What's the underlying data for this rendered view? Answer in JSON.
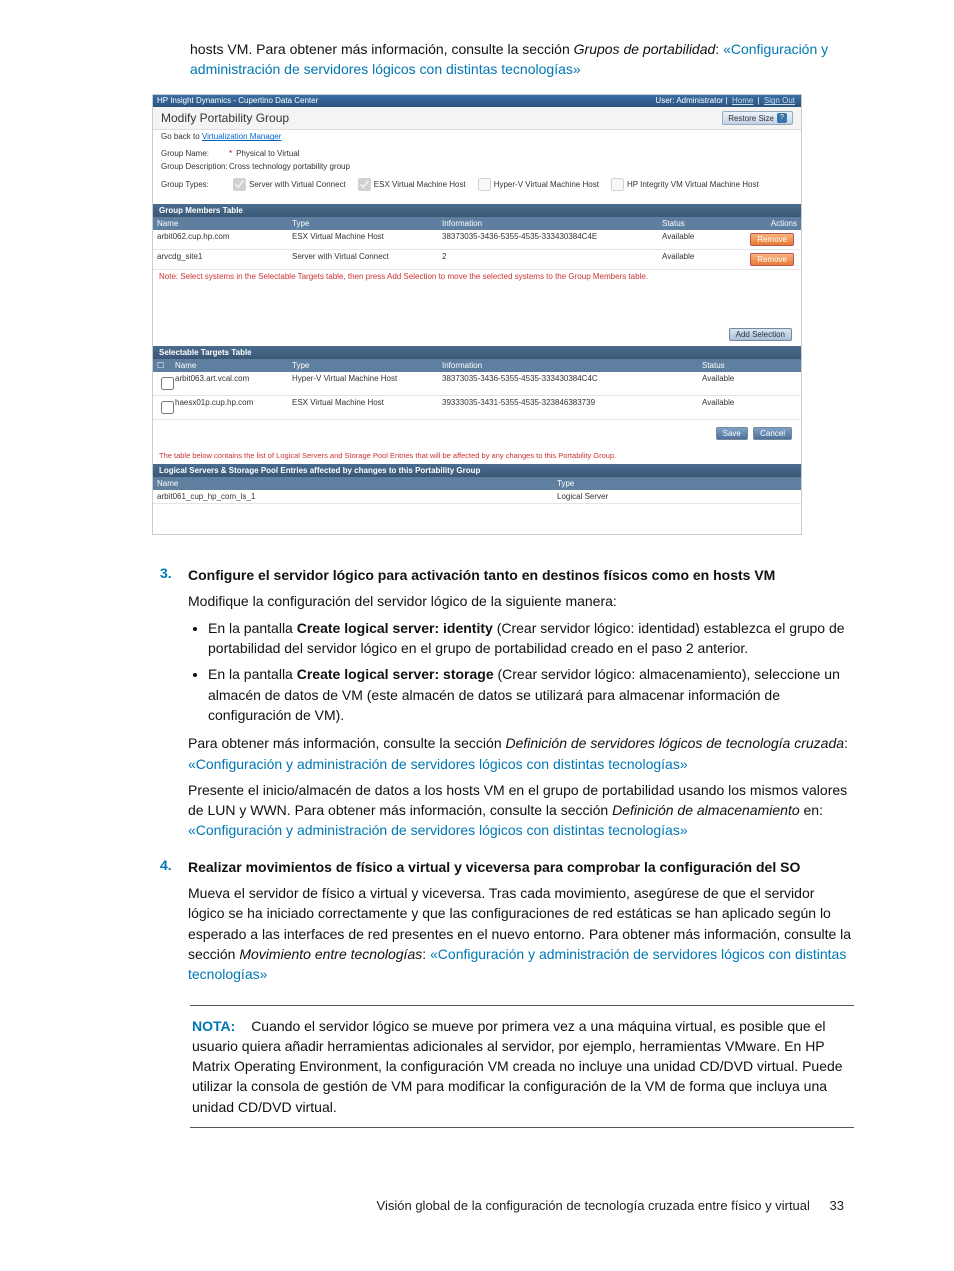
{
  "intro": {
    "prefix": "hosts VM. Para obtener más información, consulte la sección ",
    "italic": "Grupos de portabilidad",
    "colon": ": ",
    "link": "«Configuración y administración de servidores lógicos con distintas tecnologías»"
  },
  "screenshot": {
    "titlebar_left": "HP Insight Dynamics - Cupertino Data Center",
    "titlebar_right_user": "User: Administrator",
    "titlebar_right_home": "Home",
    "titlebar_right_signout": "Sign Out",
    "page_title": "Modify Portability Group",
    "restore_size": "Restore Size",
    "go_back": "Go back to ",
    "go_back_link": "Virtualization Manager",
    "form": {
      "group_name_lbl": "Group Name:",
      "group_name_val": "Physical to Virtual",
      "group_desc_lbl": "Group Description:",
      "group_desc_val": "Cross technology portability group",
      "group_types_lbl": "Group Types:",
      "type1": "Server with Virtual Connect",
      "type2": "ESX Virtual Machine Host",
      "type3": "Hyper-V Virtual Machine Host",
      "type4": "HP Integrity VM Virtual Machine Host"
    },
    "members_title": "Group Members Table",
    "cols": {
      "name": "Name",
      "type": "Type",
      "info": "Information",
      "status": "Status",
      "actions": "Actions"
    },
    "members": [
      {
        "name": "arbit062.cup.hp.com",
        "type": "ESX Virtual Machine Host",
        "info": "38373035-3436-5355-4535-333430384C4E",
        "status": "Available",
        "action": "Remove"
      },
      {
        "name": "arvcdg_site1",
        "type": "Server with Virtual Connect",
        "info": "2",
        "status": "Available",
        "action": "Remove"
      }
    ],
    "note_text": "Note: Select systems in the Selectable Targets table, then press Add Selection to move the selected systems to the Group Members table.",
    "add_selection": "Add Selection",
    "selectable_title": "Selectable Targets Table",
    "selectable": [
      {
        "name": "arbit063.art.vcal.com",
        "type": "Hyper-V Virtual Machine Host",
        "info": "38373035-3436-5355-4535-333430384C4C",
        "status": "Available"
      },
      {
        "name": "haesx01p.cup.hp.com",
        "type": "ESX Virtual Machine Host",
        "info": "39333035-3431-5355-4535-323846383739",
        "status": "Available"
      }
    ],
    "save": "Save",
    "cancel": "Cancel",
    "bottom_note": "The table below contains the list of Logical Servers and Storage Pool Entries that will be affected by any changes to this Portability Group.",
    "affected_title": "Logical Servers & Storage Pool Entries affected by changes to this Portability Group",
    "aff_cols": {
      "name": "Name",
      "type": "Type"
    },
    "affected": [
      {
        "name": "arbit061_cup_hp_com_ls_1",
        "type": "Logical Server"
      }
    ]
  },
  "step3": {
    "num": "3.",
    "head": "Configure el servidor lógico para activación tanto en destinos físicos como en hosts VM",
    "p1": "Modifique la configuración del servidor lógico de la siguiente manera:",
    "b1_a": "En la pantalla ",
    "b1_b": "Create logical server: identity",
    "b1_c": " (Crear servidor lógico: identidad) establezca el grupo de portabilidad del servidor lógico en el grupo de portabilidad creado en el paso 2 anterior.",
    "b2_a": "En la pantalla ",
    "b2_b": "Create logical server: storage",
    "b2_c": " (Crear servidor lógico: almacenamiento), seleccione un almacén de datos de VM (este almacén de datos se utilizará para almacenar información de configuración de VM).",
    "p2_a": "Para obtener más información, consulte la sección ",
    "p2_b": "Definición de servidores lógicos de tecnología cruzada",
    "p2_c": ": ",
    "p2_link": "«Configuración y administración de servidores lógicos con distintas tecnologías»",
    "p3_a": "Presente el inicio/almacén de datos a los hosts VM en el grupo de portabilidad usando los mismos valores de LUN y WWN. Para obtener más información, consulte la sección ",
    "p3_b": "Definición de almacenamiento",
    "p3_c": " en: ",
    "p3_link": "«Configuración y administración de servidores lógicos con distintas tecnologías»"
  },
  "step4": {
    "num": "4.",
    "head": "Realizar movimientos de físico a virtual y viceversa para comprobar la configuración del SO",
    "p1_a": "Mueva el servidor de físico a virtual y viceversa. Tras cada movimiento, asegúrese de que el servidor lógico se ha iniciado correctamente y que las configuraciones de red estáticas se han aplicado según lo esperado a las interfaces de red presentes en el nuevo entorno. Para obtener más información, consulte la sección ",
    "p1_b": "Movimiento entre tecnologías",
    "p1_c": ": ",
    "p1_link": "«Configuración y administración de servidores lógicos con distintas tecnologías»"
  },
  "note": {
    "label": "NOTA:",
    "text": "Cuando el servidor lógico se mueve por primera vez a una máquina virtual, es posible que el usuario quiera añadir herramientas adicionales al servidor, por ejemplo, herramientas VMware. En HP Matrix Operating Environment, la configuración VM creada no incluye una unidad CD/DVD virtual. Puede utilizar la consola de gestión de VM para modificar la configuración de la VM de forma que incluya una unidad CD/DVD virtual."
  },
  "footer": {
    "text": "Visión global de la configuración de tecnología cruzada entre físico y virtual",
    "page": "33"
  }
}
